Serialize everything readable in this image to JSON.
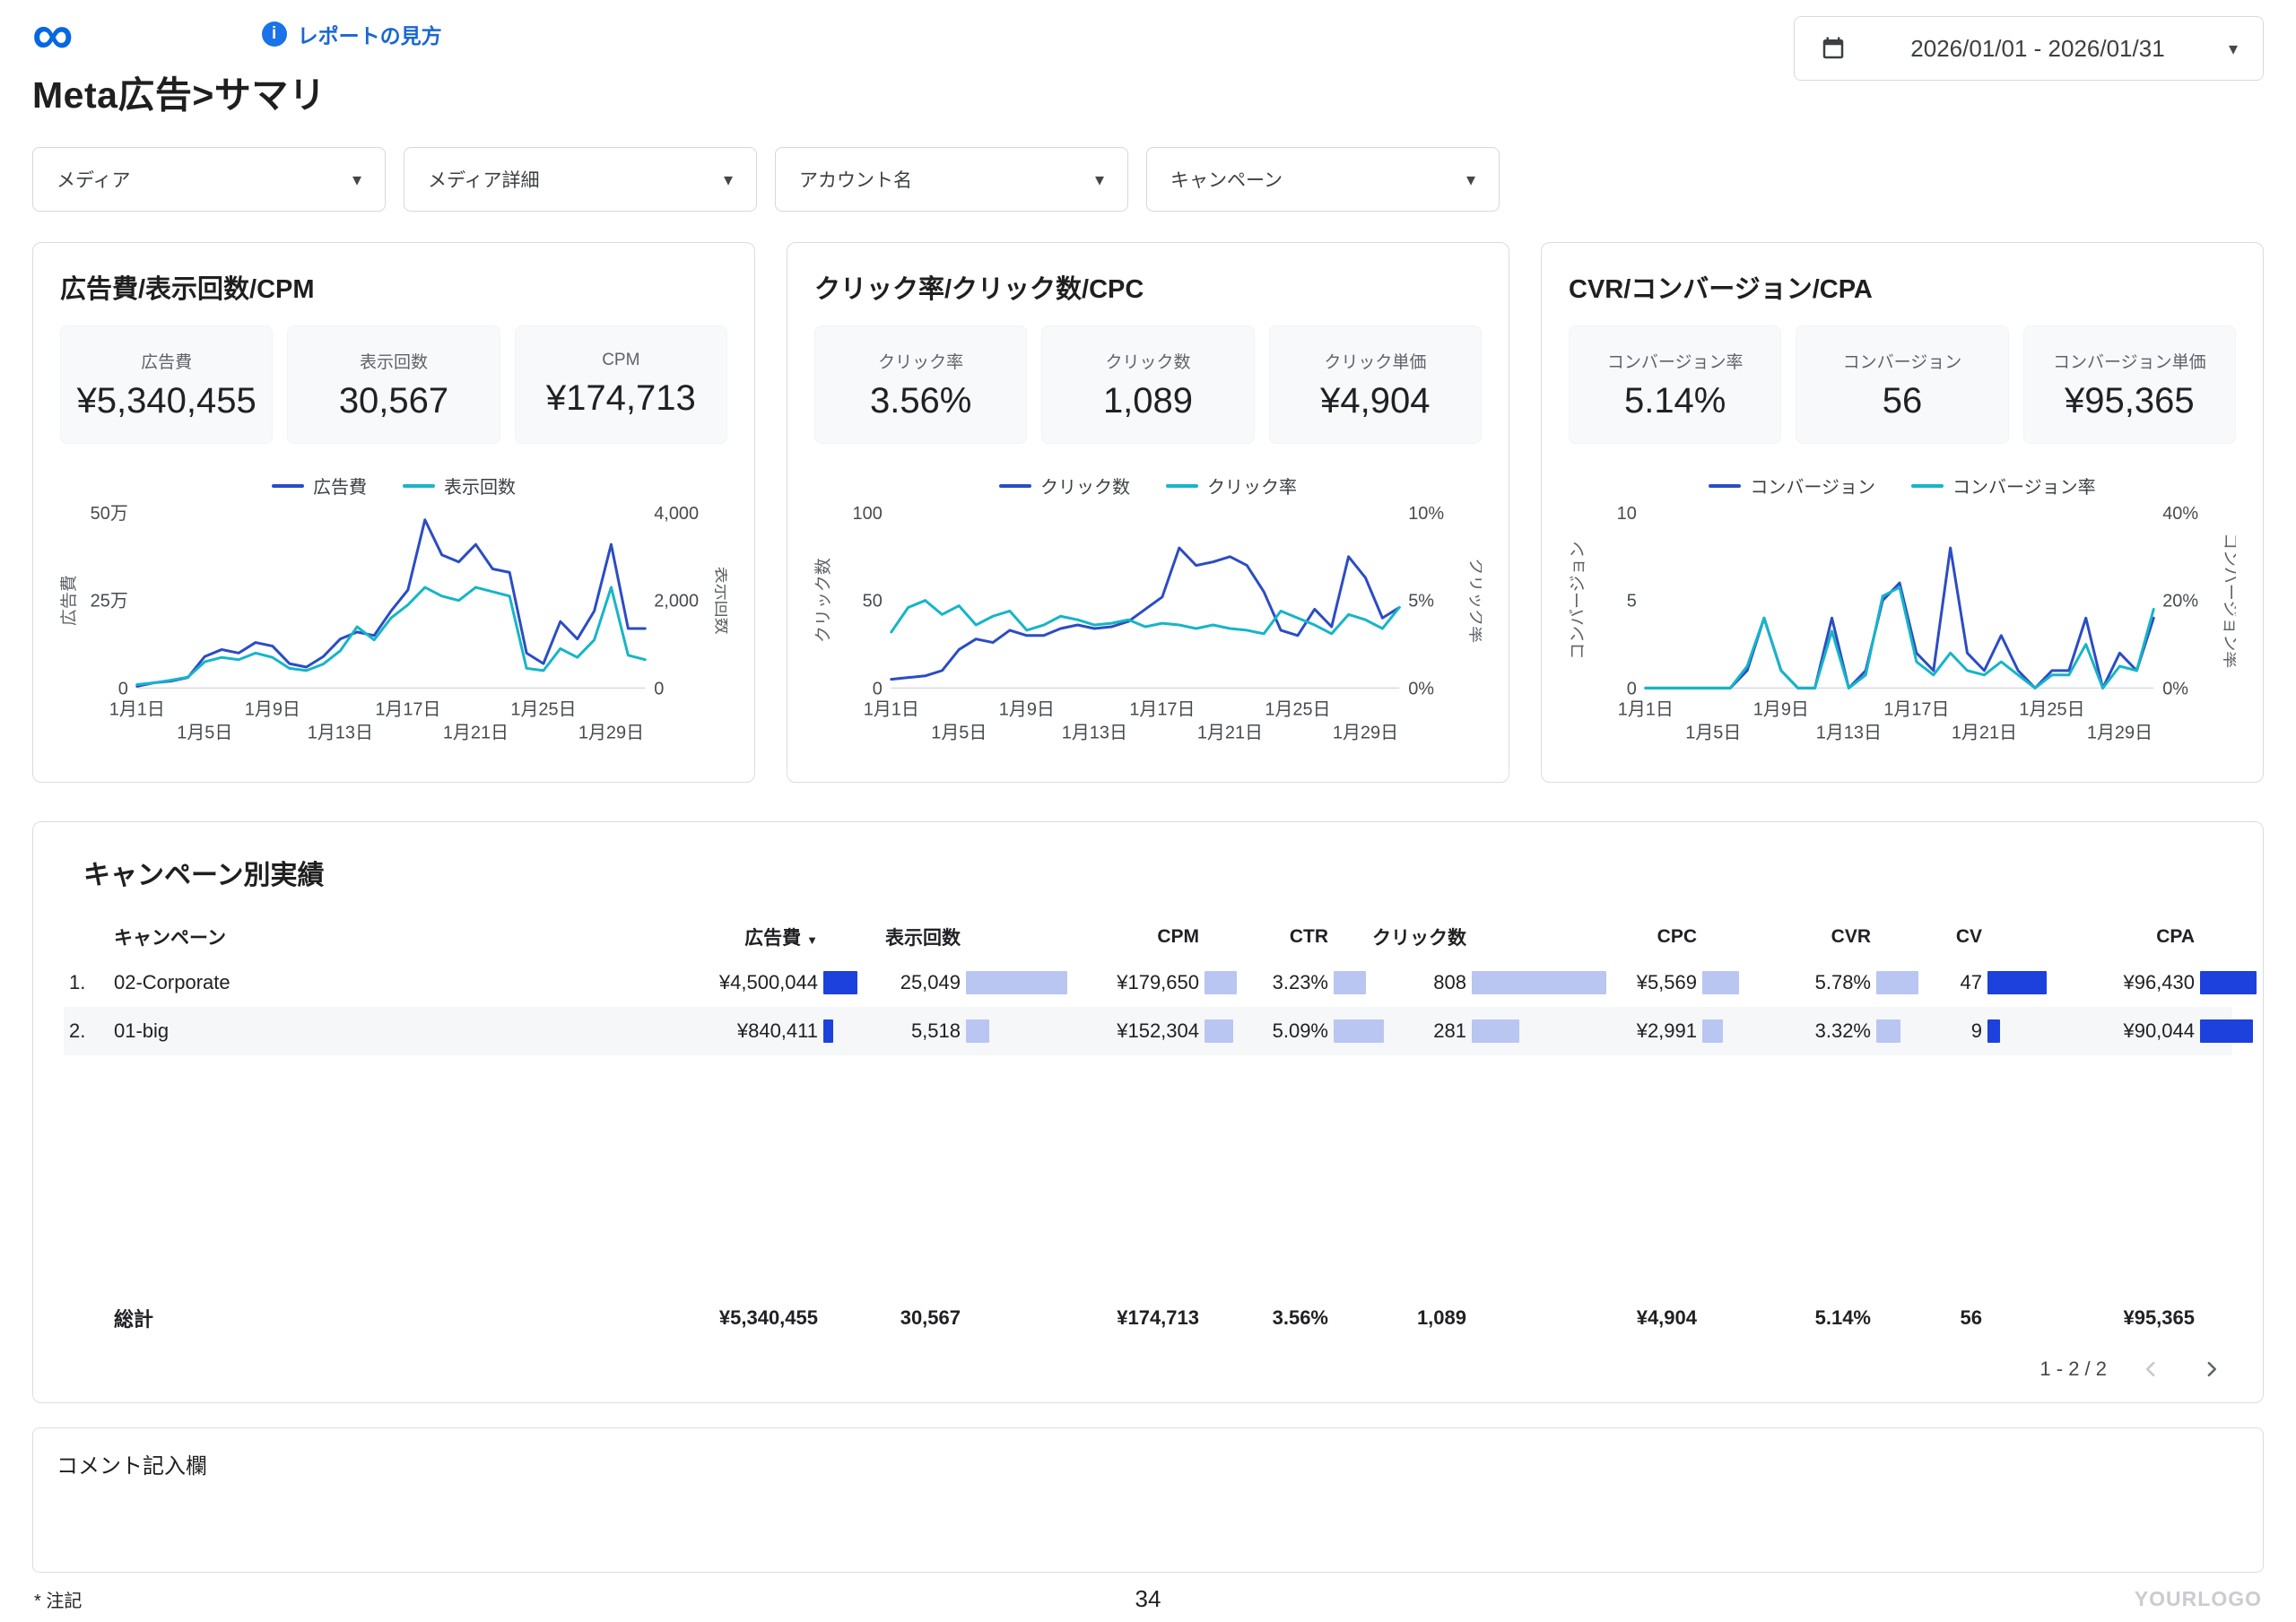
{
  "header": {
    "title": "Meta広告>サマリ",
    "info_link": "レポートの見方",
    "date_range": "2026/01/01 - 2026/01/31"
  },
  "filters": [
    {
      "name": "media",
      "label": "メディア"
    },
    {
      "name": "media-detail",
      "label": "メディア詳細"
    },
    {
      "name": "account-name",
      "label": "アカウント名"
    },
    {
      "name": "campaign",
      "label": "キャンペーン"
    }
  ],
  "colors": {
    "line_blue": "#2b4cc4",
    "line_teal": "#16b5c8",
    "bar_dark": "#1d41dc",
    "bar_light": "#b9c6f2"
  },
  "chart_data": [
    {
      "type": "line",
      "title": "広告費/表示回数/CPM",
      "kpis": [
        {
          "label": "広告費",
          "value": "¥5,340,455"
        },
        {
          "label": "表示回数",
          "value": "30,567"
        },
        {
          "label": "CPM",
          "value": "¥174,713"
        }
      ],
      "points": 31,
      "x_ticks": [
        {
          "i": 0,
          "label": "1月1日"
        },
        {
          "i": 4,
          "label": "1月5日"
        },
        {
          "i": 8,
          "label": "1月9日"
        },
        {
          "i": 12,
          "label": "1月13日"
        },
        {
          "i": 16,
          "label": "1月17日"
        },
        {
          "i": 20,
          "label": "1月21日"
        },
        {
          "i": 24,
          "label": "1月25日"
        },
        {
          "i": 28,
          "label": "1月29日"
        }
      ],
      "left_axis": {
        "label": "広告費",
        "min": 0,
        "max": 500000,
        "ticks": [
          "0",
          "25万",
          "50万"
        ]
      },
      "right_axis": {
        "label": "表示回数",
        "min": 0,
        "max": 4000,
        "ticks": [
          "0",
          "2,000",
          "4,000"
        ]
      },
      "series": [
        {
          "name": "広告費",
          "axis": "left",
          "color": "#2b4cc4",
          "values": [
            5000,
            15000,
            20000,
            30000,
            90000,
            110000,
            100000,
            130000,
            120000,
            70000,
            60000,
            90000,
            140000,
            160000,
            150000,
            220000,
            280000,
            480000,
            380000,
            360000,
            410000,
            340000,
            330000,
            100000,
            70000,
            190000,
            140000,
            220000,
            410000,
            170000,
            170000
          ]
        },
        {
          "name": "表示回数",
          "axis": "right",
          "color": "#16b5c8",
          "values": [
            80,
            120,
            180,
            250,
            600,
            700,
            650,
            800,
            700,
            450,
            400,
            550,
            850,
            1400,
            1100,
            1600,
            1900,
            2300,
            2100,
            2000,
            2300,
            2200,
            2100,
            450,
            400,
            900,
            700,
            1100,
            2300,
            750,
            650
          ]
        }
      ]
    },
    {
      "type": "line",
      "title": "クリック率/クリック数/CPC",
      "kpis": [
        {
          "label": "クリック率",
          "value": "3.56%"
        },
        {
          "label": "クリック数",
          "value": "1,089"
        },
        {
          "label": "クリック単価",
          "value": "¥4,904"
        }
      ],
      "points": 31,
      "x_ticks": [
        {
          "i": 0,
          "label": "1月1日"
        },
        {
          "i": 4,
          "label": "1月5日"
        },
        {
          "i": 8,
          "label": "1月9日"
        },
        {
          "i": 12,
          "label": "1月13日"
        },
        {
          "i": 16,
          "label": "1月17日"
        },
        {
          "i": 20,
          "label": "1月21日"
        },
        {
          "i": 24,
          "label": "1月25日"
        },
        {
          "i": 28,
          "label": "1月29日"
        }
      ],
      "left_axis": {
        "label": "クリック数",
        "min": 0,
        "max": 100,
        "ticks": [
          "0",
          "50",
          "100"
        ]
      },
      "right_axis": {
        "label": "クリック率",
        "min": 0,
        "max": 10,
        "ticks": [
          "0%",
          "5%",
          "10%"
        ]
      },
      "series": [
        {
          "name": "クリック数",
          "axis": "left",
          "color": "#2b4cc4",
          "values": [
            5,
            6,
            7,
            10,
            22,
            28,
            26,
            33,
            30,
            30,
            34,
            36,
            34,
            35,
            38,
            45,
            52,
            80,
            70,
            72,
            75,
            70,
            55,
            33,
            30,
            45,
            35,
            75,
            63,
            40,
            46
          ]
        },
        {
          "name": "クリック率",
          "axis": "right",
          "color": "#16b5c8",
          "values": [
            3.2,
            4.6,
            5.0,
            4.2,
            4.7,
            3.6,
            4.1,
            4.4,
            3.3,
            3.6,
            4.1,
            3.9,
            3.6,
            3.7,
            3.9,
            3.5,
            3.7,
            3.6,
            3.4,
            3.6,
            3.4,
            3.3,
            3.1,
            4.4,
            4.0,
            3.6,
            3.1,
            4.2,
            3.9,
            3.4,
            4.6
          ]
        }
      ]
    },
    {
      "type": "line",
      "title": "CVR/コンバージョン/CPA",
      "kpis": [
        {
          "label": "コンバージョン率",
          "value": "5.14%"
        },
        {
          "label": "コンバージョン",
          "value": "56"
        },
        {
          "label": "コンバージョン単価",
          "value": "¥95,365"
        }
      ],
      "points": 31,
      "x_ticks": [
        {
          "i": 0,
          "label": "1月1日"
        },
        {
          "i": 4,
          "label": "1月5日"
        },
        {
          "i": 8,
          "label": "1月9日"
        },
        {
          "i": 12,
          "label": "1月13日"
        },
        {
          "i": 16,
          "label": "1月17日"
        },
        {
          "i": 20,
          "label": "1月21日"
        },
        {
          "i": 24,
          "label": "1月25日"
        },
        {
          "i": 28,
          "label": "1月29日"
        }
      ],
      "left_axis": {
        "label": "コンバージョン",
        "min": 0,
        "max": 10,
        "ticks": [
          "0",
          "5",
          "10"
        ]
      },
      "right_axis": {
        "label": "コンバージョン率",
        "min": 0,
        "max": 40,
        "ticks": [
          "0%",
          "20%",
          "40%"
        ]
      },
      "series": [
        {
          "name": "コンバージョン",
          "axis": "left",
          "color": "#2b4cc4",
          "values": [
            0,
            0,
            0,
            0,
            0,
            0,
            1,
            4,
            1,
            0,
            0,
            4,
            0,
            1,
            5,
            6,
            2,
            1,
            8,
            2,
            1,
            3,
            1,
            0,
            1,
            1,
            4,
            0,
            2,
            1,
            4
          ]
        },
        {
          "name": "コンバージョン率",
          "axis": "right",
          "color": "#16b5c8",
          "values": [
            0,
            0,
            0,
            0,
            0,
            0,
            5,
            16,
            4,
            0,
            0,
            13,
            0,
            3,
            21,
            23,
            6,
            3,
            8,
            4,
            3,
            6,
            3,
            0,
            3,
            3,
            10,
            0,
            5,
            4,
            18
          ]
        }
      ]
    }
  ],
  "table": {
    "title": "キャンペーン別実績",
    "columns": [
      {
        "label": "キャンペーン"
      },
      {
        "label": "広告費",
        "sorted": true
      },
      {
        "label": "表示回数"
      },
      {
        "label": "CPM"
      },
      {
        "label": "CTR"
      },
      {
        "label": "クリック数"
      },
      {
        "label": "CPC"
      },
      {
        "label": "CVR"
      },
      {
        "label": "CV"
      },
      {
        "label": "CPA"
      }
    ],
    "sort_icon": "▼",
    "rows": [
      {
        "index": "1.",
        "campaign": "02-Corporate",
        "cells": [
          {
            "v": "¥4,500,044",
            "bar": 0.25,
            "tone": "dark"
          },
          {
            "v": "25,049",
            "bar": 0.75,
            "tone": "light"
          },
          {
            "v": "¥179,650",
            "bar": 0.24,
            "tone": "light"
          },
          {
            "v": "3.23%",
            "bar": 0.24,
            "tone": "light"
          },
          {
            "v": "808",
            "bar": 1.0,
            "tone": "light"
          },
          {
            "v": "¥5,569",
            "bar": 0.27,
            "tone": "light"
          },
          {
            "v": "5.78%",
            "bar": 0.31,
            "tone": "light"
          },
          {
            "v": "47",
            "bar": 0.44,
            "tone": "dark"
          },
          {
            "v": "¥96,430",
            "bar": 0.42,
            "tone": "dark"
          }
        ]
      },
      {
        "index": "2.",
        "campaign": "01-big",
        "cells": [
          {
            "v": "¥840,411",
            "bar": 0.07,
            "tone": "dark"
          },
          {
            "v": "5,518",
            "bar": 0.17,
            "tone": "light"
          },
          {
            "v": "¥152,304",
            "bar": 0.21,
            "tone": "light"
          },
          {
            "v": "5.09%",
            "bar": 0.37,
            "tone": "light"
          },
          {
            "v": "281",
            "bar": 0.35,
            "tone": "light"
          },
          {
            "v": "¥2,991",
            "bar": 0.15,
            "tone": "light"
          },
          {
            "v": "3.32%",
            "bar": 0.18,
            "tone": "light"
          },
          {
            "v": "9",
            "bar": 0.09,
            "tone": "dark"
          },
          {
            "v": "¥90,044",
            "bar": 0.39,
            "tone": "dark"
          }
        ]
      }
    ],
    "total": {
      "label": "総計",
      "values": [
        "¥5,340,455",
        "30,567",
        "¥174,713",
        "3.56%",
        "1,089",
        "¥4,904",
        "5.14%",
        "56",
        "¥95,365"
      ]
    },
    "pagination": "1 - 2 / 2"
  },
  "comment_label": "コメント記入欄",
  "footer": {
    "note": "* 注記",
    "page": "34",
    "logo": "YOURLOGO"
  }
}
